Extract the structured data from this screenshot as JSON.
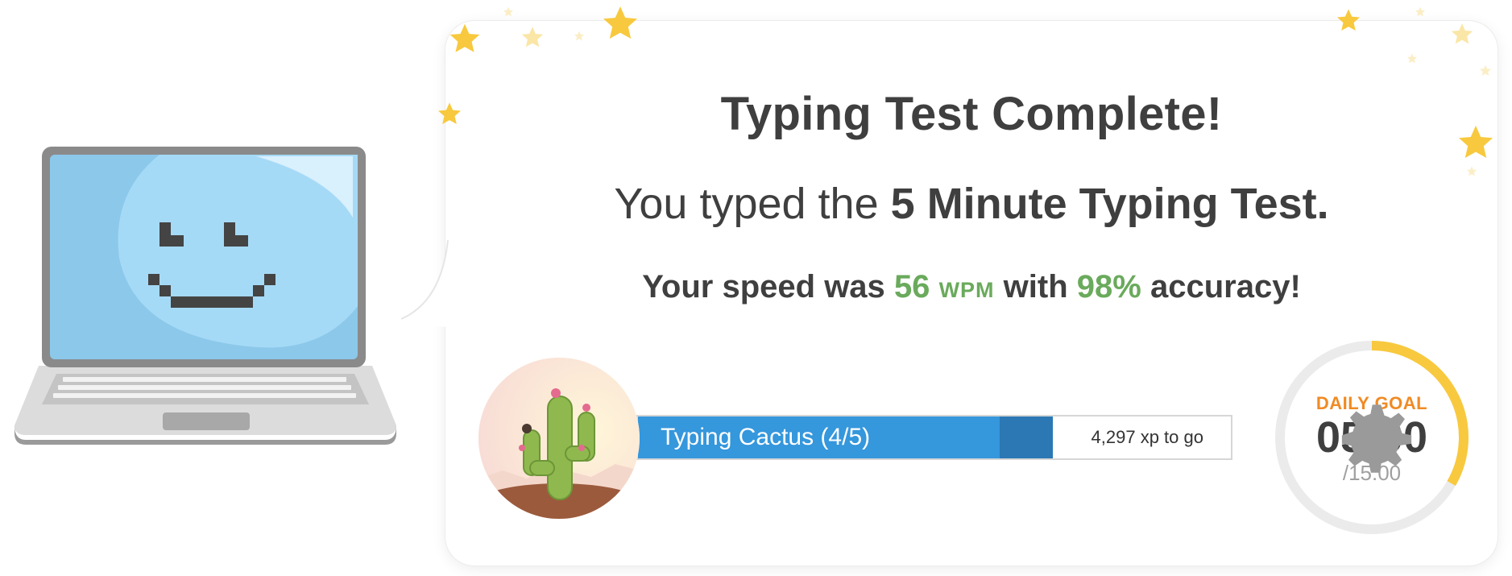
{
  "result": {
    "title": "Typing Test Complete!",
    "subtitle_prefix": "You typed the",
    "subtitle_test": "5 Minute Typing Test.",
    "speed_prefix": "Your speed was",
    "wpm_value": "56",
    "wpm_unit": "WPM",
    "speed_middle": "with",
    "accuracy_value": "98%",
    "accuracy_suffix": "accuracy!"
  },
  "badge": {
    "icon": "cactus-badge-icon",
    "level_label": "Typing Cactus (4/5)",
    "xp_to_go": "4,297 xp to go",
    "progress_fraction": 0.7,
    "recent_gain_fraction": 0.09
  },
  "daily_goal": {
    "label": "DAILY GOAL",
    "time": "05:00",
    "total": "/15:00",
    "progress_fraction": 0.3333,
    "settings_icon": "gear-icon"
  },
  "colors": {
    "accent_green": "#6aaa5c",
    "progress_blue": "#3597dc",
    "progress_blue_dark": "#2b78b4",
    "goal_orange": "#f08a24",
    "goal_ring_yellow": "#f8c93e",
    "star_yellow": "#f8c93e"
  },
  "mascot": {
    "icon": "smiling-laptop-icon"
  }
}
